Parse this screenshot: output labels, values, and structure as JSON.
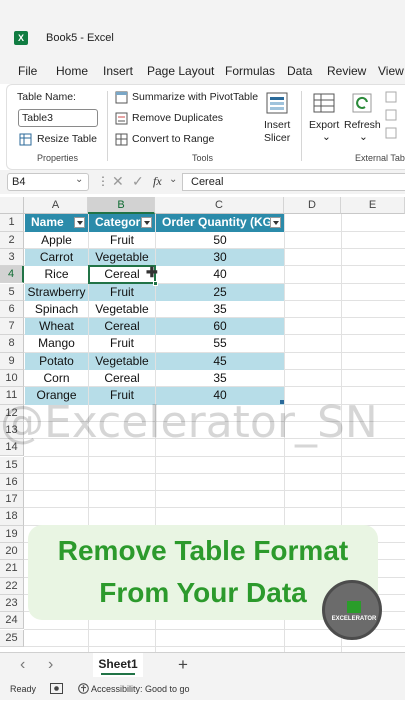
{
  "window": {
    "app_letter": "X",
    "title": "Book5  -  Excel"
  },
  "menu": {
    "tabs": [
      "File",
      "Home",
      "Insert",
      "Page Layout",
      "Formulas",
      "Data",
      "Review",
      "View"
    ]
  },
  "ribbon": {
    "table_name_label": "Table Name:",
    "table_name_value": "Table3",
    "resize_table": "Resize Table",
    "properties_group": "Properties",
    "summarize_pivot": "Summarize with PivotTable",
    "remove_duplicates": "Remove Duplicates",
    "convert_to_range": "Convert to Range",
    "tools_group": "Tools",
    "insert_slicer_1": "Insert",
    "insert_slicer_2": "Slicer",
    "export": "Export",
    "refresh": "Refresh",
    "external_group": "External Table"
  },
  "formula_bar": {
    "name_box": "B4",
    "fx": "fx",
    "value": "Cereal"
  },
  "sheet": {
    "columns": [
      "A",
      "B",
      "C",
      "D",
      "E"
    ],
    "rows": [
      "1",
      "2",
      "3",
      "4",
      "5",
      "6",
      "7",
      "8",
      "9",
      "10",
      "11",
      "12",
      "13",
      "14",
      "15",
      "16",
      "17",
      "18",
      "19",
      "20",
      "21",
      "22",
      "23",
      "24",
      "25"
    ],
    "headers": [
      "Name",
      "Categor",
      "Order Quantity (KG"
    ],
    "data": [
      [
        "Apple",
        "Fruit",
        "50"
      ],
      [
        "Carrot",
        "Vegetable",
        "30"
      ],
      [
        "Rice",
        "Cereal",
        "40"
      ],
      [
        "Strawberry",
        "Fruit",
        "25"
      ],
      [
        "Spinach",
        "Vegetable",
        "35"
      ],
      [
        "Wheat",
        "Cereal",
        "60"
      ],
      [
        "Mango",
        "Fruit",
        "55"
      ],
      [
        "Potato",
        "Vegetable",
        "45"
      ],
      [
        "Corn",
        "Cereal",
        "35"
      ],
      [
        "Orange",
        "Fruit",
        "40"
      ]
    ],
    "active_cell": "B4"
  },
  "watermark": "@Excelerator_SN",
  "banner": {
    "line1": "Remove Table Format",
    "line2": "From Your Data",
    "badge": "EXCELERATOR"
  },
  "tabs": {
    "sheet1": "Sheet1",
    "add": "+",
    "prev": "‹",
    "next": "›"
  },
  "status": {
    "ready": "Ready",
    "accessibility": "Accessibility: Good to go"
  }
}
